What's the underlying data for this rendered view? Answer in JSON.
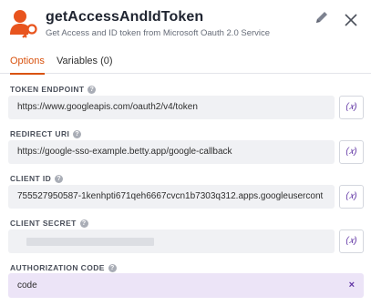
{
  "header": {
    "title": "getAccessAndIdToken",
    "subtitle": "Get Access and ID token from Microsoft Oauth 2.0 Service",
    "icon": "key-user-icon",
    "accent_color": "#e8541e"
  },
  "tabs": [
    {
      "label": "Options",
      "active": true
    },
    {
      "label": "Variables (0)",
      "active": false
    }
  ],
  "fields": [
    {
      "label": "TOKEN ENDPOINT",
      "value": "https://www.googleapis.com/oauth2/v4/token",
      "var_label": "(𝑥)"
    },
    {
      "label": "REDIRECT URI",
      "value": "https://google-sso-example.betty.app/google-callback",
      "var_label": "(𝑥)"
    },
    {
      "label": "CLIENT ID",
      "value": "755527950587-1kenhpti671qeh6667cvcn1b7303q312.apps.googleusercont",
      "var_label": "(𝑥)"
    },
    {
      "label": "CLIENT SECRET",
      "value": "",
      "var_label": "(𝑥)"
    }
  ],
  "auth_code": {
    "label": "AUTHORIZATION CODE",
    "value": "code",
    "clear": "×"
  },
  "colors": {
    "tab_active": "#d9530f",
    "variable_purple": "#6236a5",
    "auth_bg": "#ece4f7"
  }
}
